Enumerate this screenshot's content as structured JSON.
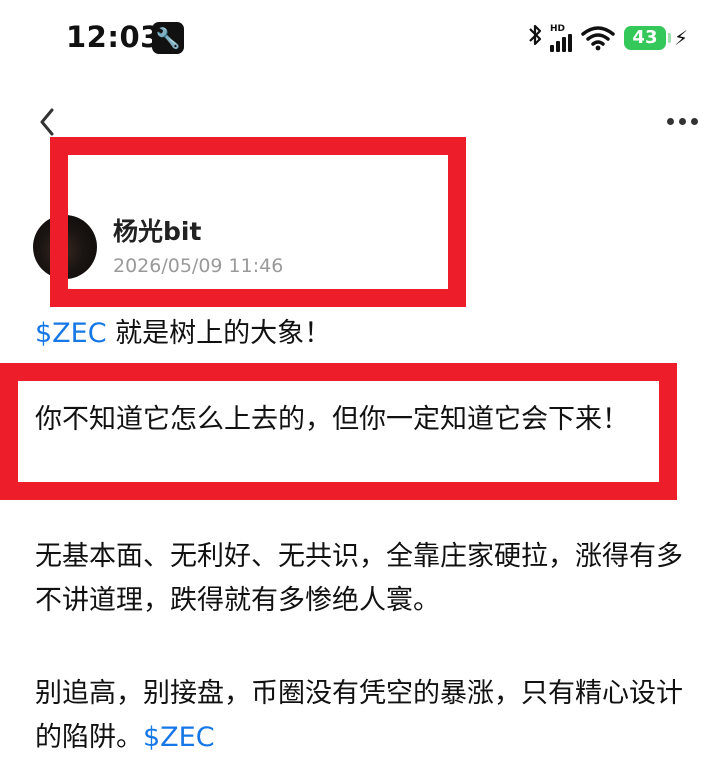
{
  "status_bar": {
    "time": "12:03",
    "hd_label": "HD",
    "battery": "43",
    "signal_bars": 4,
    "icons": [
      "wrench-icon",
      "bluetooth-icon",
      "signal-icon",
      "wifi-icon",
      "battery-icon",
      "charging-icon"
    ]
  },
  "nav": {
    "back_icon": "chevron-left-icon",
    "more_icon": "more-dots-icon"
  },
  "author": {
    "name": "杨光bit",
    "timestamp": "2026/05/09 11:46"
  },
  "post": {
    "p1_tag": "$ZEC",
    "p1_text": " 就是树上的大象！",
    "p2_text": "你不知道它怎么上去的，但你一定知道它会下来！",
    "p3_text": "无基本面、无利好、无共识，全靠庄家硬拉，涨得有多不讲道理，跌得就有多惨绝人寰。",
    "p4_text": "别追高，别接盘，币圈没有凭空的暴涨，只有精心设计的陷阱。",
    "p4_tag": "$ZEC"
  },
  "colors": {
    "tag": "#1677e6",
    "highlight_box": "#ee1d2a",
    "battery": "#34c759",
    "timestamp": "#9a9a9a"
  }
}
